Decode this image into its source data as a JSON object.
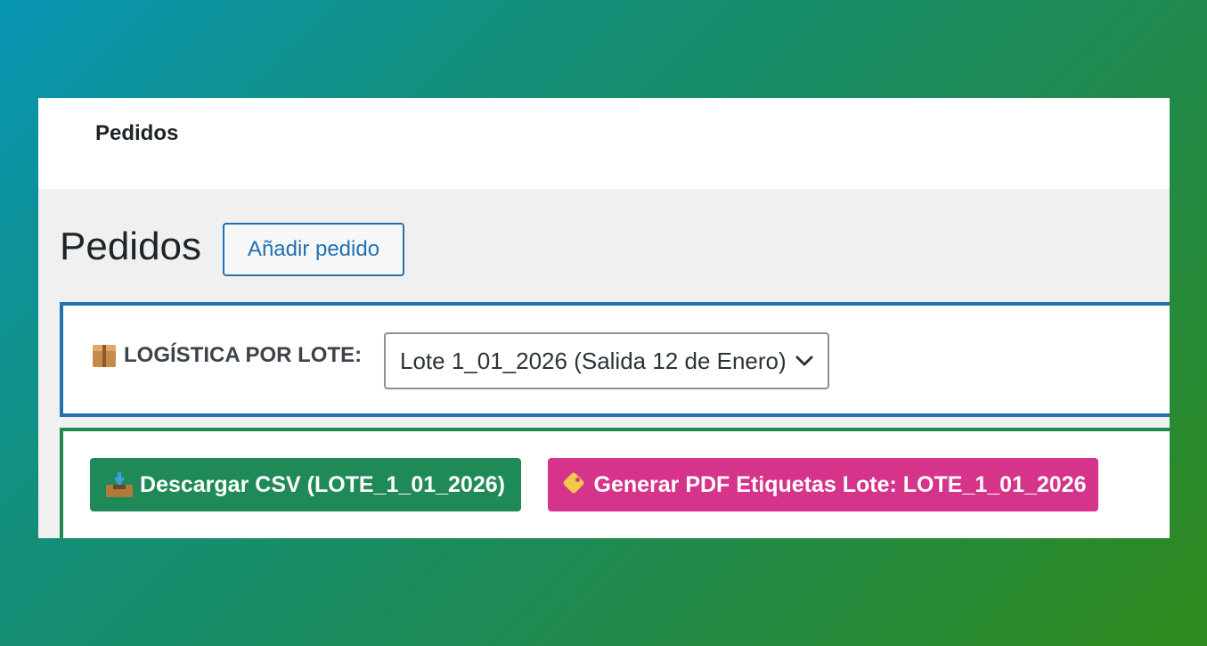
{
  "topbar": {
    "title": "Pedidos"
  },
  "page": {
    "heading": "Pedidos",
    "add_button_label": "Añadir pedido"
  },
  "logistics": {
    "label": "LOGÍSTICA POR LOTE:",
    "label_icon": "package-icon",
    "select": {
      "selected_value": "Lote 1_01_2026 (Salida 12 de Enero)",
      "icon": "chevron-down-icon"
    }
  },
  "actions": {
    "csv_button": {
      "label": "Descargar CSV (LOTE_1_01_2026)",
      "icon": "inbox-tray-icon",
      "color": "#1f8a58"
    },
    "pdf_button": {
      "label": "Generar PDF Etiquetas Lote: LOTE_1_01_2026",
      "icon": "tag-icon",
      "color": "#d6338a"
    }
  },
  "colors": {
    "accent_blue": "#2271b1",
    "accent_green": "#1f8a4c"
  }
}
